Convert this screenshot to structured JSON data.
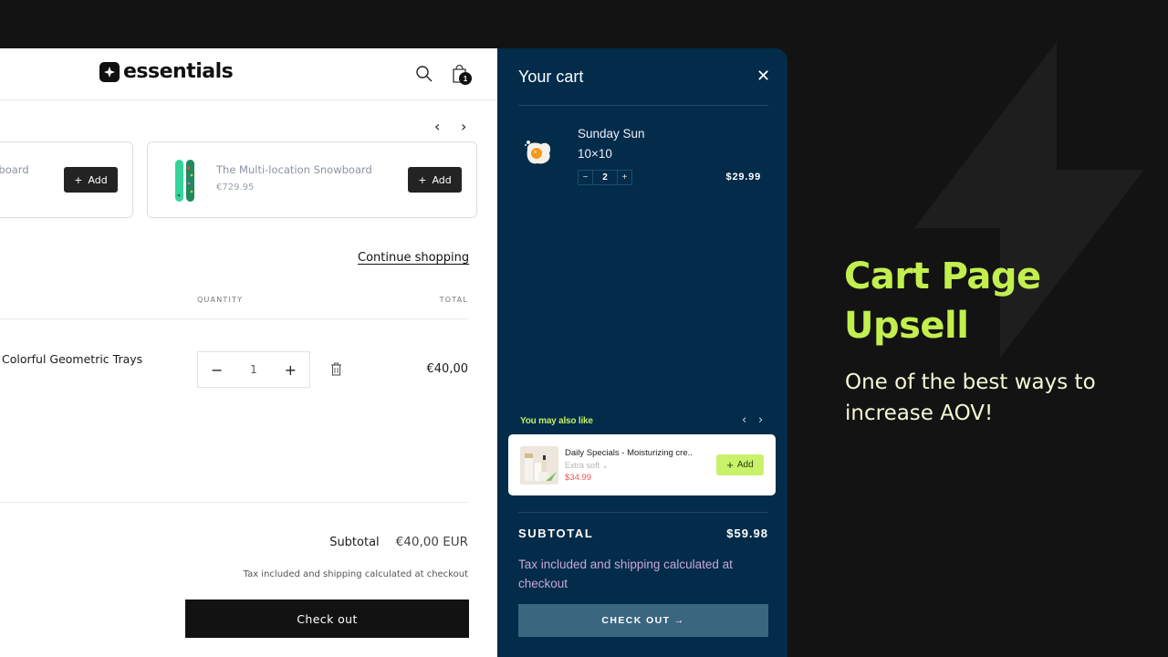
{
  "store": {
    "logo_text": "essentials",
    "cart_count": "1",
    "recommendations": [
      {
        "title": "wboard",
        "add_label": "Add"
      },
      {
        "title": "The Multi-location Snowboard",
        "price": "€729.95",
        "add_label": "Add"
      }
    ],
    "continue_shopping": "Continue shopping",
    "columns": {
      "quantity": "QUANTITY",
      "total": "TOTAL"
    },
    "line_item": {
      "name": "Colorful Geometric Trays",
      "quantity": "1",
      "total": "€40,00"
    },
    "subtotal_label": "Subtotal",
    "subtotal_value": "€40,00 EUR",
    "tax_note": "Tax included and shipping calculated at checkout",
    "checkout_label": "Check out"
  },
  "drawer": {
    "title": "Your cart",
    "close_symbol": "✕",
    "item": {
      "name": "Sunday Sun",
      "variant": "10×10",
      "quantity": "2",
      "price": "$29.99"
    },
    "upsell": {
      "heading": "You may also like",
      "product": {
        "name": "Daily Specials - Moisturizing cre..",
        "variant": "Extra soft",
        "price": "$34.99",
        "add_label": "Add"
      }
    },
    "subtotal_label": "SUBTOTAL",
    "subtotal_value": "$59.98",
    "tax_note": "Tax included and shipping calculated at checkout",
    "checkout_label": "CHECK OUT →"
  },
  "promo": {
    "title_line1": "Cart Page",
    "title_line2": "Upsell",
    "subtitle_line1": "One of the best ways to",
    "subtitle_line2": "increase AOV!"
  },
  "colors": {
    "accent": "#c2ef4e",
    "drawer_bg": "#022c4a",
    "page_bg": "#131313",
    "sale_price": "#f05252"
  }
}
